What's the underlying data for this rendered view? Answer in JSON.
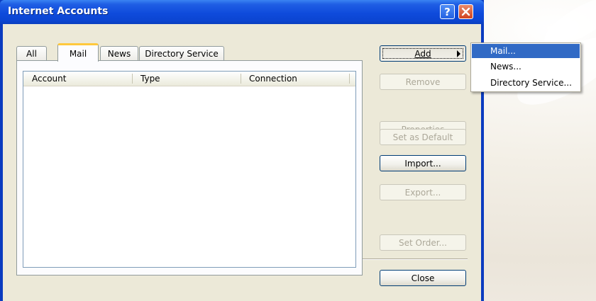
{
  "window": {
    "title": "Internet Accounts"
  },
  "tabs": [
    {
      "label": "All"
    },
    {
      "label": "Mail"
    },
    {
      "label": "News"
    },
    {
      "label": "Directory Service"
    }
  ],
  "active_tab": "Mail",
  "list": {
    "columns": [
      "Account",
      "Type",
      "Connection"
    ],
    "rows": []
  },
  "buttons": {
    "add": "Add",
    "remove": "Remove",
    "properties": "Properties",
    "set_default": "Set as Default",
    "import": "Import...",
    "export": "Export...",
    "set_order": "Set Order...",
    "close": "Close"
  },
  "add_menu": {
    "items": [
      "Mail...",
      "News...",
      "Directory Service..."
    ],
    "highlighted": "Mail..."
  },
  "colors": {
    "title_bar": "#0f4bdc",
    "menu_highlight": "#316ac5",
    "tab_active_accent": "#ffc83c"
  }
}
